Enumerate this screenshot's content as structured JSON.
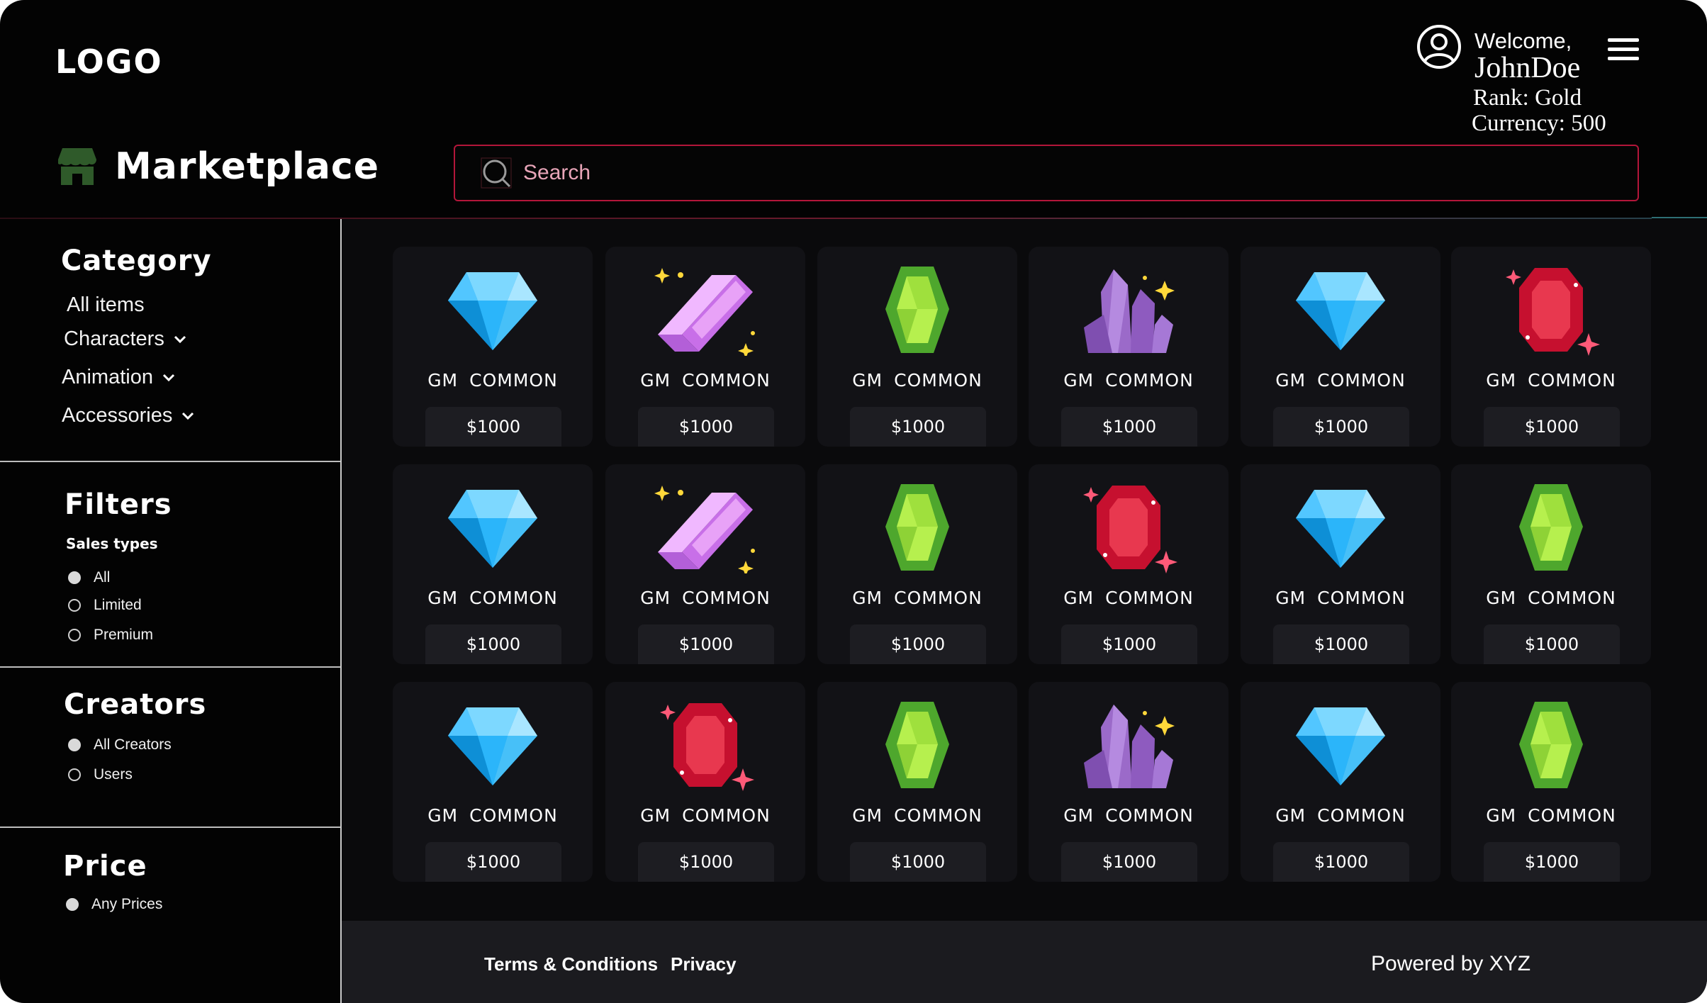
{
  "header": {
    "logo": "LOGO",
    "title": "Marketplace",
    "search_placeholder": "Search",
    "user": {
      "welcome": "Welcome,",
      "name": "JohnDoe",
      "rank": "Rank: Gold",
      "currency": "Currency: 500"
    }
  },
  "sidebar": {
    "category": {
      "heading": "Category",
      "items": [
        {
          "label": "All items"
        },
        {
          "label": "Characters"
        },
        {
          "label": "Animation"
        },
        {
          "label": "Accessories"
        }
      ]
    },
    "filters": {
      "heading": "Filters",
      "sub_label": "Sales types",
      "options": [
        {
          "label": "All",
          "selected": true
        },
        {
          "label": "Limited",
          "selected": false
        },
        {
          "label": "Premium",
          "selected": false
        }
      ]
    },
    "creators": {
      "heading": "Creators",
      "options": [
        {
          "label": "All Creators",
          "selected": true
        },
        {
          "label": "Users",
          "selected": false
        }
      ]
    },
    "price": {
      "heading": "Price",
      "options": [
        {
          "label": "Any Prices",
          "selected": true
        }
      ]
    }
  },
  "items": [
    {
      "gem": "blue-diamond",
      "prefix": "GM",
      "rarity": "COMMON",
      "price": "$1000"
    },
    {
      "gem": "pink-crystal",
      "prefix": "GM",
      "rarity": "COMMON",
      "price": "$1000"
    },
    {
      "gem": "green-emerald",
      "prefix": "GM",
      "rarity": "COMMON",
      "price": "$1000"
    },
    {
      "gem": "purple-crystal-cluster",
      "prefix": "GM",
      "rarity": "COMMON",
      "price": "$1000"
    },
    {
      "gem": "blue-diamond",
      "prefix": "GM",
      "rarity": "COMMON",
      "price": "$1000"
    },
    {
      "gem": "red-ruby",
      "prefix": "GM",
      "rarity": "COMMON",
      "price": "$1000"
    },
    {
      "gem": "blue-diamond",
      "prefix": "GM",
      "rarity": "COMMON",
      "price": "$1000"
    },
    {
      "gem": "pink-crystal",
      "prefix": "GM",
      "rarity": "COMMON",
      "price": "$1000"
    },
    {
      "gem": "green-emerald",
      "prefix": "GM",
      "rarity": "COMMON",
      "price": "$1000"
    },
    {
      "gem": "red-ruby",
      "prefix": "GM",
      "rarity": "COMMON",
      "price": "$1000"
    },
    {
      "gem": "blue-diamond",
      "prefix": "GM",
      "rarity": "COMMON",
      "price": "$1000"
    },
    {
      "gem": "green-emerald",
      "prefix": "GM",
      "rarity": "COMMON",
      "price": "$1000"
    },
    {
      "gem": "blue-diamond",
      "prefix": "GM",
      "rarity": "COMMON",
      "price": "$1000"
    },
    {
      "gem": "red-ruby",
      "prefix": "GM",
      "rarity": "COMMON",
      "price": "$1000"
    },
    {
      "gem": "green-emerald",
      "prefix": "GM",
      "rarity": "COMMON",
      "price": "$1000"
    },
    {
      "gem": "purple-crystal-cluster",
      "prefix": "GM",
      "rarity": "COMMON",
      "price": "$1000"
    },
    {
      "gem": "blue-diamond",
      "prefix": "GM",
      "rarity": "COMMON",
      "price": "$1000"
    },
    {
      "gem": "green-emerald",
      "prefix": "GM",
      "rarity": "COMMON",
      "price": "$1000"
    }
  ],
  "footer": {
    "terms": "Terms & Conditions",
    "privacy": "Privacy",
    "powered": "Powered by  XYZ"
  },
  "colors": {
    "background": "#030303",
    "card": "#121216",
    "search_border": "#b3163a",
    "store_icon": "#2f5a2a"
  }
}
